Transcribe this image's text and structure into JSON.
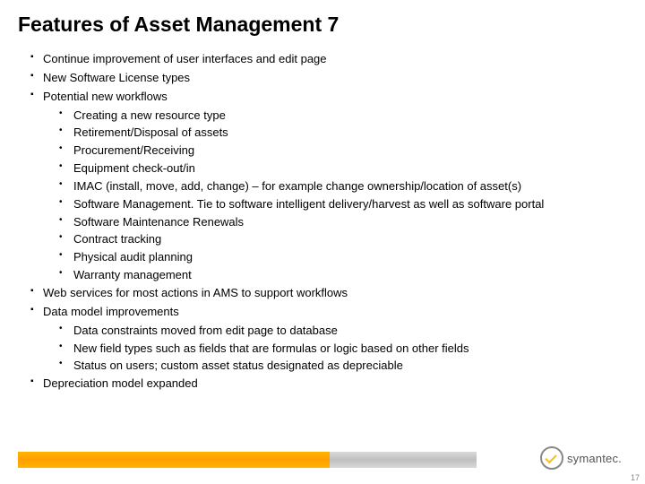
{
  "title": "Features of Asset Management 7",
  "bullets_top": [
    "Continue improvement of user interfaces and edit page",
    "New Software License types",
    "Potential new workflows"
  ],
  "sub_workflows": [
    "Creating a new resource type",
    "Retirement/Disposal of assets",
    "Procurement/Receiving",
    "Equipment check-out/in",
    " IMAC (install, move, add, change) – for example change ownership/location of asset(s)",
    "Software Management.  Tie to software intelligent delivery/harvest as well as software portal",
    "Software Maintenance Renewals",
    "Contract tracking",
    "Physical audit planning",
    "Warranty management"
  ],
  "bullets_mid": [
    "Web services for most actions in AMS to support workflows",
    "Data model improvements"
  ],
  "sub_datamodel": [
    "Data constraints moved from edit page to database",
    "New field types such as fields that are formulas or logic based on other fields",
    "Status on users; custom asset status designated as depreciable"
  ],
  "bullets_last": [
    "Depreciation model expanded"
  ],
  "logo_text": "symantec.",
  "page_number": "17"
}
